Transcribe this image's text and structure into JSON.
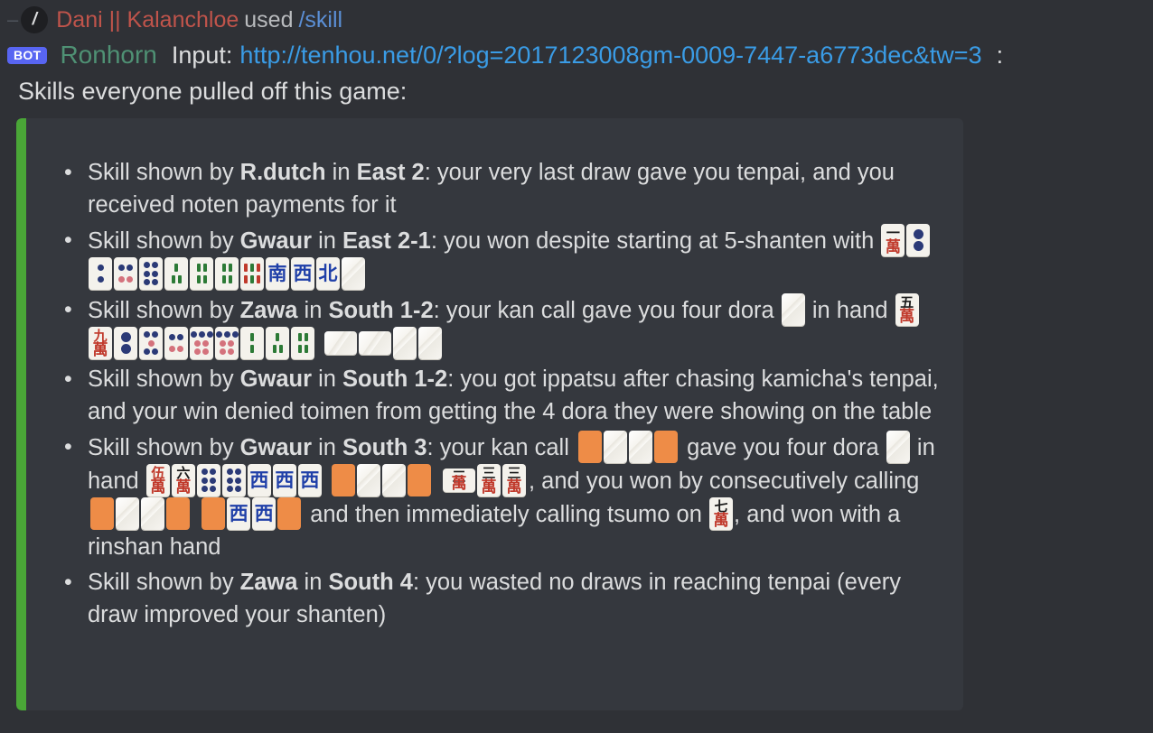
{
  "system_line": {
    "collapse_icon": "minus-icon",
    "avatar_glyph": "/",
    "username": "Dani || Kalanchloe",
    "action": "used",
    "command": "/skill"
  },
  "bot_line": {
    "badge": "BOT",
    "bot_name": "Ronhorn",
    "input_label": "Input:",
    "url": "http://tenhou.net/0/?log=2017123008gm-0009-7447-a6773dec&tw=3",
    "trailing": ":"
  },
  "message": {
    "body": "Skills everyone pulled off this game:"
  },
  "embed": {
    "accent_color": "#4aa637",
    "background_color": "#35383e",
    "items": [
      {
        "prefix": "Skill shown by ",
        "player": "R.dutch",
        "mid": " in ",
        "round": "East 2",
        "text": ": your very last draw gave you tenpai, and you received noten payments for it",
        "tiles": []
      },
      {
        "prefix": "Skill shown by ",
        "player": "Gwaur",
        "mid": " in ",
        "round": "East 2-1",
        "text": ": you won despite starting at 5-shanten with",
        "tiles": [
          "1m",
          "1p",
          "2p",
          "4p",
          "6p",
          "3s",
          "4s",
          "4s",
          "6s",
          "south",
          "west",
          "north",
          "back"
        ]
      },
      {
        "prefix": "Skill shown by ",
        "player": "Zawa",
        "mid": " in ",
        "round": "South 1-2",
        "text": ": your kan call gave you four dora",
        "text2": "in hand",
        "tiles_inline": [
          "back"
        ],
        "tiles": [
          "5m",
          "9m-red",
          "1p",
          "5p",
          "4p",
          "7p",
          "7p",
          "2s",
          "3s",
          "4s",
          "kan-rot-rot-back-back"
        ]
      },
      {
        "prefix": "Skill shown by ",
        "player": "Gwaur",
        "mid": " in ",
        "round": "South 1-2",
        "text": ": you got ippatsu after chasing kamicha's tenpai, and your win denied toimen from getting the 4 dora they were showing on the table",
        "tiles": []
      },
      {
        "prefix": "Skill shown by ",
        "player": "Gwaur",
        "mid": " in ",
        "round": "South 3",
        "seg1": ": your kan call",
        "kan1": [
          "ph",
          "back",
          "back",
          "ph"
        ],
        "seg2": "gave you four dora",
        "dora": [
          "back"
        ],
        "seg3": "in hand",
        "hand": [
          "5m",
          "6m",
          "6p",
          "6p",
          "west",
          "west",
          "west"
        ],
        "kan2": [
          "ph",
          "back",
          "back",
          "ph"
        ],
        "meld3": [
          "3m-rot",
          "3m",
          "3m"
        ],
        "seg4": ", and you won by consecutively calling",
        "kan3": [
          "ph",
          "back",
          "back",
          "ph"
        ],
        "kan4": [
          "ph",
          "west",
          "west",
          "ph"
        ],
        "seg5": "and then immediately calling tsumo on",
        "tsumo": [
          "7m"
        ],
        "seg6": ", and won with a rinshan hand"
      },
      {
        "prefix": "Skill shown by ",
        "player": "Zawa",
        "mid": " in ",
        "round": "South 4",
        "text": ": you wasted no draws in reaching tenpai (every draw improved your shanten)",
        "tiles": []
      }
    ]
  }
}
